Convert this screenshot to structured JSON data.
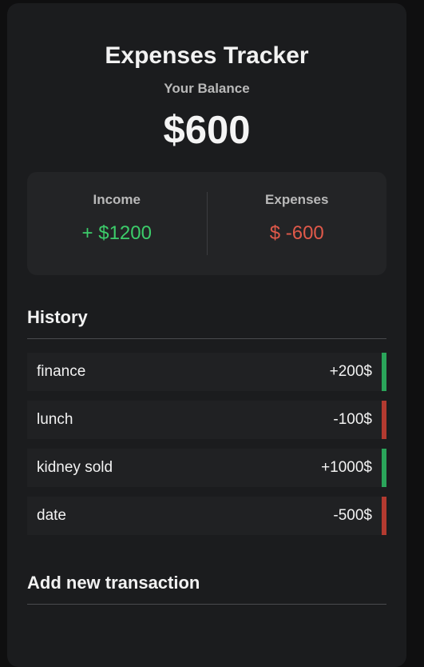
{
  "app": {
    "title": "Expenses Tracker",
    "balance_label": "Your Balance",
    "balance_value": "$600"
  },
  "summary": {
    "income_label": "Income",
    "income_value": "+ $1200",
    "expenses_label": "Expenses",
    "expenses_value": "$ -600"
  },
  "history": {
    "title": "History",
    "items": [
      {
        "name": "finance",
        "amount": "+200$",
        "type": "plus"
      },
      {
        "name": "lunch",
        "amount": "-100$",
        "type": "minus"
      },
      {
        "name": "kidney sold",
        "amount": "+1000$",
        "type": "plus"
      },
      {
        "name": "date",
        "amount": "-500$",
        "type": "minus"
      }
    ]
  },
  "add_transaction": {
    "title": "Add new transaction"
  },
  "colors": {
    "income": "#3ccc6a",
    "expense": "#e0594a",
    "plus_bar": "#2aa55a",
    "minus_bar": "#b33a30"
  }
}
